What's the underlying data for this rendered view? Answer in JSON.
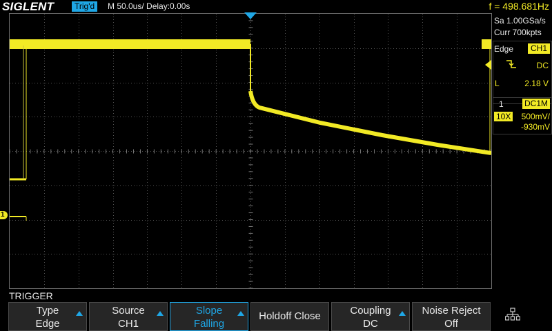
{
  "header": {
    "brand": "SIGLENT",
    "trigger_status": "Trig'd",
    "timebase": "M 50.0us/",
    "delay": "Delay:0.00s",
    "frequency": "f = 498.681Hz"
  },
  "acquisition": {
    "sample_rate": "Sa 1.00GSa/s",
    "memory_depth": "Curr 700kpts"
  },
  "trigger_info": {
    "type": "Edge",
    "source": "CH1",
    "slope_icon": "falling-edge-icon",
    "coupling": "DC",
    "level_label": "L",
    "level": "2.18 V"
  },
  "channel_info": {
    "number": "1",
    "coupling": "DC1M",
    "probe": "10X",
    "volts_per_div": "500mV/",
    "offset": "-930mV"
  },
  "channel_marker": "1",
  "menu": {
    "title": "TRIGGER",
    "softkeys": [
      {
        "line1": "Type",
        "line2": "Edge",
        "arrow": true,
        "active": false
      },
      {
        "line1": "Source",
        "line2": "CH1",
        "arrow": true,
        "active": false
      },
      {
        "line1": "Slope",
        "line2": "Falling",
        "arrow": true,
        "active": true
      },
      {
        "line1": "Holdoff Close",
        "line2": "",
        "arrow": false,
        "active": false
      },
      {
        "line1": "Coupling",
        "line2": "DC",
        "arrow": true,
        "active": false
      },
      {
        "line1": "Noise Reject",
        "line2": "Off",
        "arrow": false,
        "active": false
      }
    ],
    "extra_icon": "network-icon"
  },
  "colors": {
    "trace": "#f2ea25",
    "accent": "#1fa7e6",
    "grid": "#6b6b6b"
  }
}
